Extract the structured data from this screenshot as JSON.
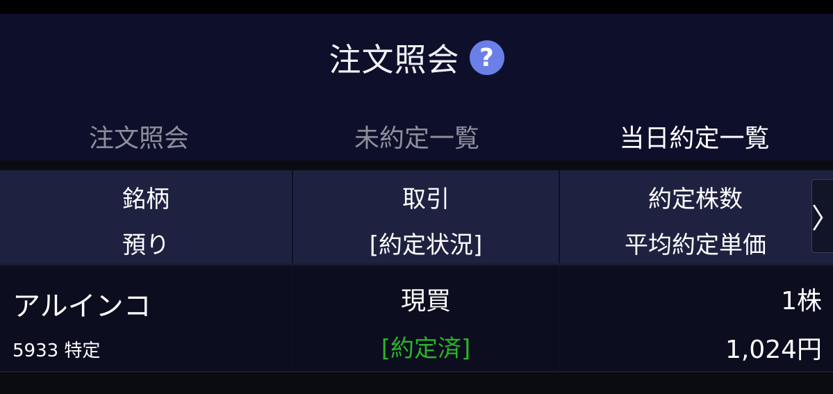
{
  "header": {
    "title": "注文照会",
    "help_icon": "question-circle-icon",
    "help_symbol": "?"
  },
  "tabs": [
    {
      "label": "注文照会",
      "active": false
    },
    {
      "label": "未約定一覧",
      "active": false
    },
    {
      "label": "当日約定一覧",
      "active": true
    }
  ],
  "table": {
    "columns": [
      {
        "line1": "銘柄",
        "line2": "預り"
      },
      {
        "line1": "取引",
        "line2": "[約定状況]"
      },
      {
        "line1": "約定株数",
        "line2": "平均約定単価"
      }
    ],
    "scroll_right_symbol": "〉",
    "rows": [
      {
        "name": "アルインコ",
        "code_account": "5933 特定",
        "trade": "現買",
        "status": "[約定済]",
        "shares": "1株",
        "price": "1,024円"
      }
    ]
  },
  "colors": {
    "header_bg": "#0d0f2b",
    "table_head_bg": "#1e2240",
    "row_bg": "#0c0d1e",
    "accent_tab": "#2aa3ea",
    "help_icon": "#6b7fe8",
    "status_filled": "#2ab52a",
    "inactive_tab": "#8e8f9a"
  }
}
